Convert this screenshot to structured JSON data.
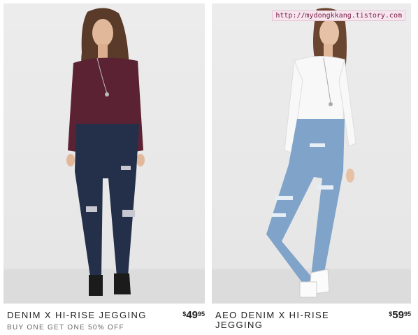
{
  "products": [
    {
      "name": "DENIM X HI-RISE JEGGING",
      "promo": "BUY ONE GET ONE 50% OFF",
      "price_currency": "$",
      "price_whole": "49",
      "price_cents": "95"
    },
    {
      "name": "AEO DENIM X HI-RISE JEGGING",
      "promo": "",
      "price_currency": "$",
      "price_whole": "59",
      "price_cents": "95"
    }
  ],
  "watermark": "http://mydongkkang.tistory.com",
  "colors": {
    "background": "#ececec",
    "text": "#222222",
    "promo_text": "#666666",
    "watermark_bg": "#f6e6ee",
    "watermark_text": "#7a1d48"
  }
}
